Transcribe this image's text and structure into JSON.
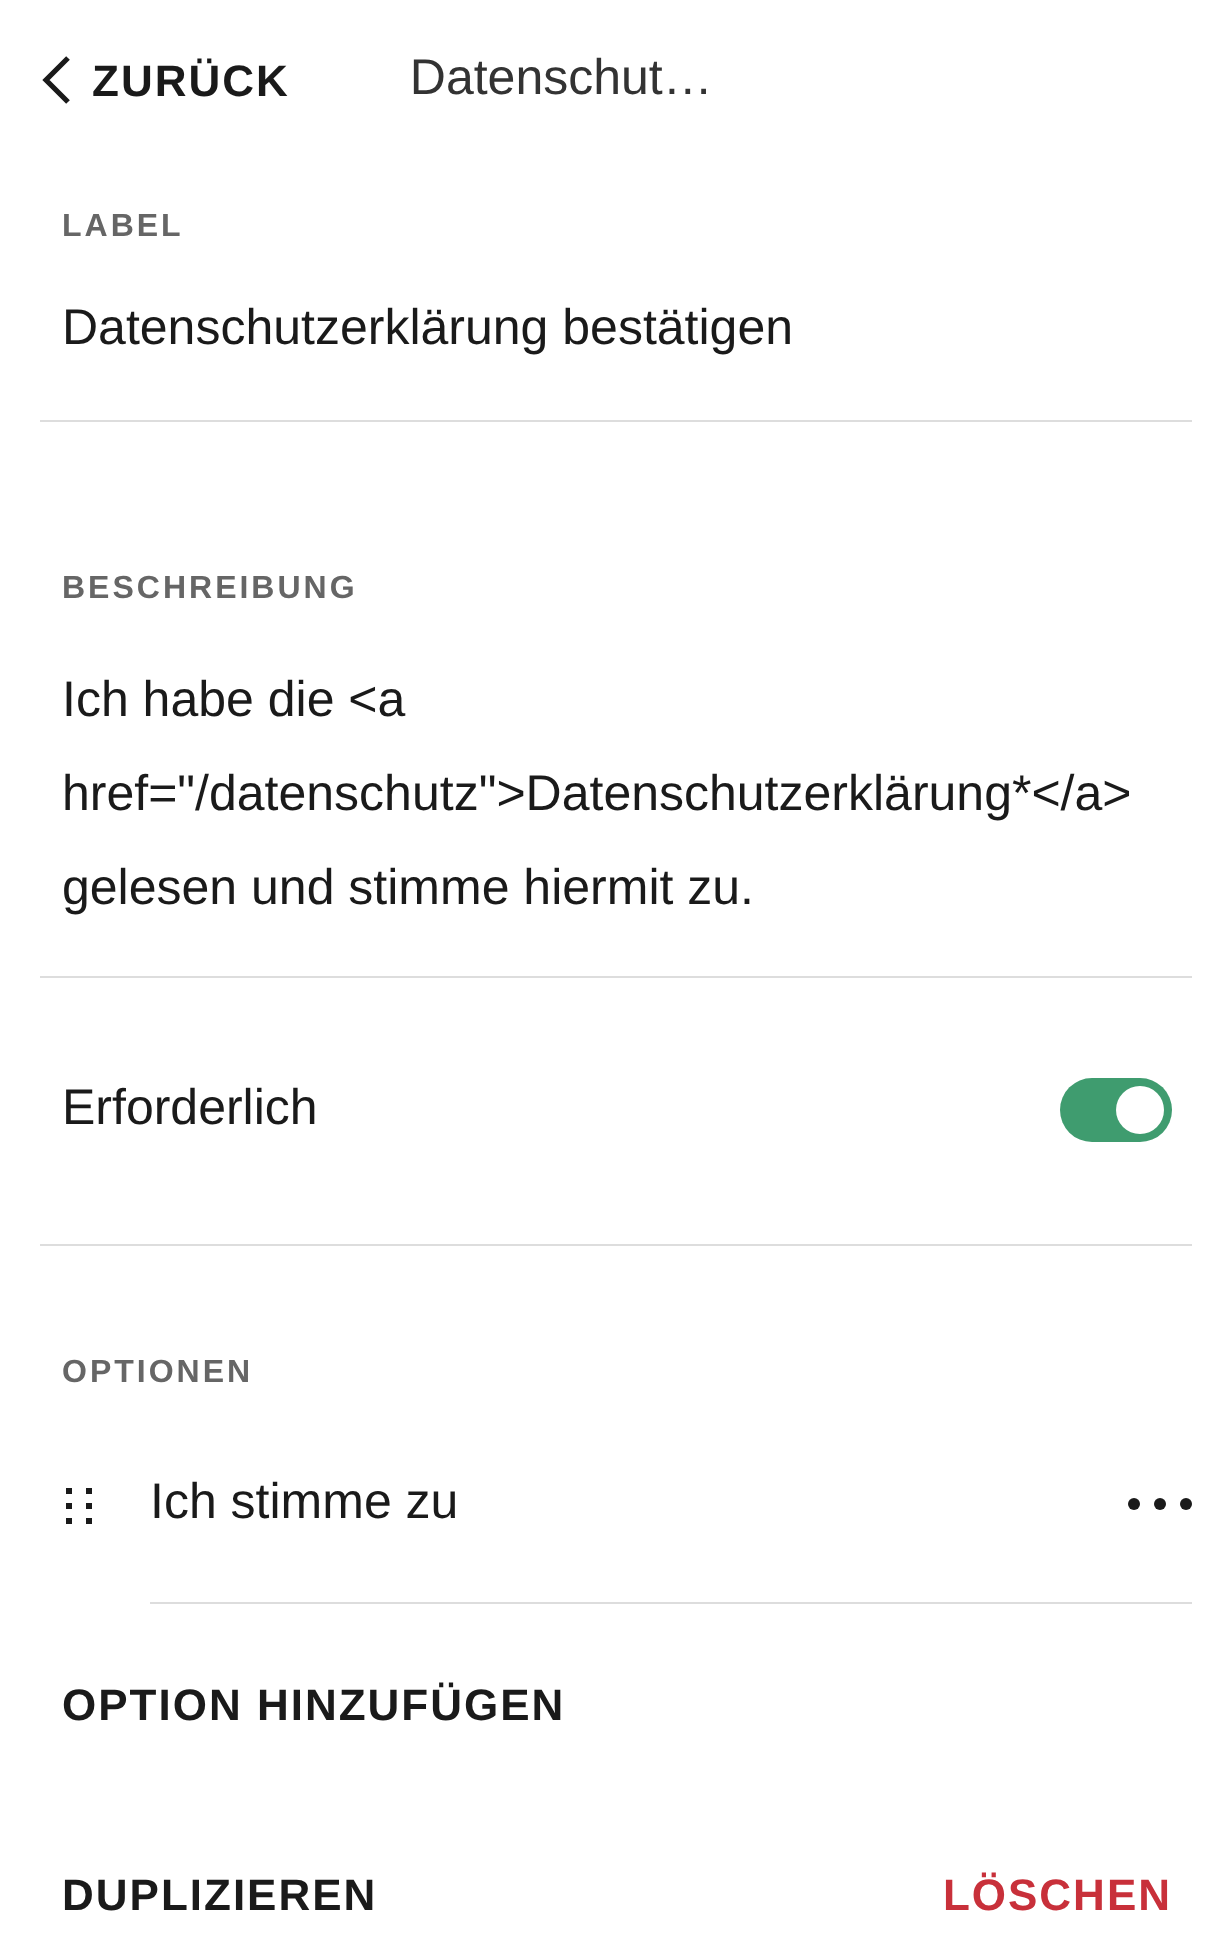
{
  "header": {
    "back": "ZURÜCK",
    "title": "Datenschut…"
  },
  "label": {
    "heading": "LABEL",
    "value": "Datenschutzerklärung bestätigen"
  },
  "description": {
    "heading": "BESCHREIBUNG",
    "value": "Ich habe die <a href=\"/datenschutz\">Datenschutzerklärung*</a> gelesen und stimme hiermit zu."
  },
  "required": {
    "label": "Erforderlich",
    "on": true
  },
  "options": {
    "heading": "OPTIONEN",
    "items": [
      {
        "label": "Ich stimme zu"
      }
    ],
    "add": "OPTION HINZUFÜGEN"
  },
  "footer": {
    "duplicate": "DUPLIZIEREN",
    "delete": "LÖSCHEN"
  }
}
